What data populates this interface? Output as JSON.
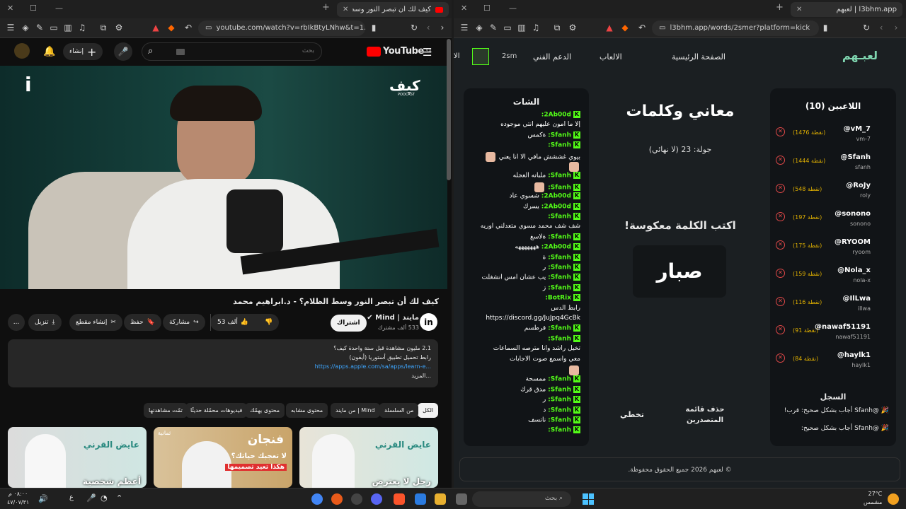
{
  "left": {
    "tab_title": "كيف لك أن تبصر النور وسط الظ",
    "url": "youtube.com/watch?v=rbIkBtyLNhw&t=1...",
    "yt": {
      "search_placeholder": "بحث",
      "create_label": "إنشاء",
      "logo_text": "YouTube",
      "logo_region": "SA",
      "video_title": "كيف لك أن تبصر النور وسط الظلام؟ - د.ابراهيم محمد",
      "brand_logo_text": "كيف",
      "brand_logo_sub": "PODCAST",
      "channel_name": "مايند | Mind",
      "subscribers": "533 ألف مشترك",
      "subscribe_label": "اشتراك",
      "like_count": "53 ألف",
      "share_label": "مشاركة",
      "save_label": "حفظ",
      "clip_label": "إنشاء مقطع",
      "download_label": "تنزيل",
      "more_label": "...",
      "desc_line1": "2.1 مليون مشاهدة  قبل سنة واحدة  كيف؟",
      "desc_line2": "رابط تحميل تطبيق أستوريا (أيفون)",
      "desc_link": "https://apps.apple.com/sa/apps/learn-e...",
      "desc_more": "...المزيد",
      "chips": [
        "الكل",
        "من السلسلة",
        "من مايند | Mind",
        "محتوى مشابه",
        "محتوى يهمّك",
        "فيديوهات محمّلة حديثًا",
        "تمّت مشاهدتها"
      ],
      "thumb1_title": "رجل لا يعترض",
      "thumb2_title": "فنجان",
      "thumb2_sub": "لا تعجبك حياتك؟",
      "thumb2_sub2": "هكذا تعيد تصميمها",
      "thumb2_badge": "ثمانية",
      "thumb3_title": "أعظم شخصية",
      "thumb_brand": "عايض القرني"
    }
  },
  "right": {
    "tab_title": "لعبهم | l3bhm.app",
    "url": "l3bhm.app/words/2smer?platform=kick",
    "nav": {
      "logo": "لعبـهم",
      "home": "الصفحة الرئيسية",
      "games": "الالعاب",
      "support": "الدعم الفني",
      "username": "2sm",
      "cut": "الا"
    },
    "players_title": "اللاعبين (10)",
    "players": [
      {
        "name": "@vM_7",
        "user": "vm-7",
        "points": "(1476 نقطة)"
      },
      {
        "name": "@Sfanh",
        "user": "sfanh",
        "points": "(1444 نقطة)"
      },
      {
        "name": "@RoJy",
        "user": "roly",
        "points": "(548 نقطة)"
      },
      {
        "name": "@sonono",
        "user": "sonono",
        "points": "(197 نقطة)"
      },
      {
        "name": "@RYOOM",
        "user": "ryoom",
        "points": "(175 نقطة)"
      },
      {
        "name": "@Nola_x",
        "user": "nola-x",
        "points": "(159 نقطة)"
      },
      {
        "name": "@IlLwa",
        "user": "illwa",
        "points": "(116 نقطة)"
      },
      {
        "name": "@nawaf51191",
        "user": "nawaf51191",
        "points": "(91 نقطة)"
      },
      {
        "name": "@haylk1",
        "user": "haylk1",
        "points": "(84 نقطة)"
      }
    ],
    "game_title": "معاني وكلمات",
    "round": "جولة: 23 (لا نهائي)",
    "instruction": "اكتب الكلمة معكوسة!",
    "word": "صبار",
    "skip_label": "تخطي",
    "reset_label": "حذف قائمة المتصدرين",
    "log_title": "السجل",
    "log": [
      "🎉 @Sfanh أجاب بشكل صحيح: قرب!",
      "🎉 @Sfanh أجاب بشكل صحيح:"
    ],
    "chat_title": "الشات",
    "chat": [
      {
        "user": "2Ab00d:",
        "msg": ""
      },
      {
        "user": "",
        "msg": "إلا ما أمون عليهم أنتي موجوده"
      },
      {
        "user": "Sfanh:",
        "msg": "ةكمس"
      },
      {
        "user": "Sfanh:",
        "msg": ""
      },
      {
        "user": "",
        "msg": "بيوي غششش مافي الا انا يعني",
        "emote": true
      },
      {
        "user": "",
        "msg": "",
        "emote": true
      },
      {
        "user": "Sfanh:",
        "msg": "ملبانه العجله"
      },
      {
        "user": "Sfanh:",
        "msg": "",
        "emote": true
      },
      {
        "user": "2Ab00d:",
        "msg": "شسوي عاد"
      },
      {
        "user": "2Ab00d:",
        "msg": "يسرك"
      },
      {
        "user": "Sfanh:",
        "msg": ""
      },
      {
        "user": "",
        "msg": "شف شف محمد مسوي متعدلني اوريه"
      },
      {
        "user": "Sfanh:",
        "msg": "ةلاسغ"
      },
      {
        "user": "2Ab00d:",
        "msg": "هههههههه"
      },
      {
        "user": "Sfanh:",
        "msg": "ة"
      },
      {
        "user": "Sfanh:",
        "msg": "ر"
      },
      {
        "user": "Sfanh:",
        "msg": "يب عشان امس انشغلت"
      },
      {
        "user": "Sfanh:",
        "msg": "ز"
      },
      {
        "user": "BotRix:",
        "msg": ""
      },
      {
        "user": "",
        "msg": "رابط الدس"
      },
      {
        "user": "",
        "msg": "https://discord.gg/JuJpq4GcBk"
      },
      {
        "user": "Sfanh:",
        "msg": "قرطسم"
      },
      {
        "user": "Sfanh:",
        "msg": ""
      },
      {
        "user": "",
        "msg": "تخيل راشد وانا مترصه السماعات"
      },
      {
        "user": "",
        "msg": "معي واسمع صوت الاجابات"
      },
      {
        "user": "",
        "msg": "",
        "emote": true
      },
      {
        "user": "Sfanh:",
        "msg": "ممسحة"
      },
      {
        "user": "Sfanh:",
        "msg": "مدق قرك"
      },
      {
        "user": "Sfanh:",
        "msg": "ر"
      },
      {
        "user": "Sfanh:",
        "msg": "د"
      },
      {
        "user": "Sfanh:",
        "msg": "ناتسف"
      },
      {
        "user": "Sfanh:",
        "msg": ""
      }
    ],
    "footer": "© لعبهم 2026 جميع الحقوق محفوظة."
  },
  "taskbar": {
    "search_placeholder": "بحث",
    "weather_temp": "27°C",
    "weather_desc": "مشمس",
    "time": "٠٨:٠٠ م",
    "date": "٤٧/٠٧/٣١",
    "lang": "ع"
  },
  "colors": {
    "kick_green": "#53fc18",
    "points_gold": "#e0b000",
    "remove_red": "#e04848",
    "yt_red": "#ff0000",
    "link_blue": "#3ea6ff"
  }
}
